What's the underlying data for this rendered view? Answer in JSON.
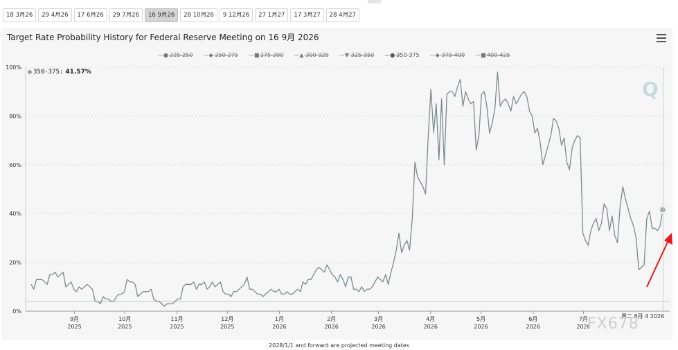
{
  "tabs": [
    {
      "label": "18 3月26",
      "active": false
    },
    {
      "label": "29 4月26",
      "active": false
    },
    {
      "label": "17 6月26",
      "active": false
    },
    {
      "label": "29 7月26",
      "active": false
    },
    {
      "label": "16 9月26",
      "active": true
    },
    {
      "label": "28 10月26",
      "active": false
    },
    {
      "label": "9 12月26",
      "active": false
    },
    {
      "label": "27 1月27",
      "active": false
    },
    {
      "label": "17 3月27",
      "active": false
    },
    {
      "label": "28 4月27",
      "active": false
    }
  ],
  "header": {
    "title": "Target Rate Probability History for Federal Reserve Meeting on 16 9月 2026"
  },
  "icons": {
    "menu": "hamburger-menu-icon",
    "logo": "q-logo-icon",
    "arrow": "red-arrow-icon"
  },
  "colors": {
    "line": "#7b8a8b",
    "marker": "#a0a0a0",
    "arrow": "#e8161a",
    "panel": "#f6f6f6"
  },
  "legend": [
    {
      "label": "225-250",
      "symbol": "●",
      "hidden": true
    },
    {
      "label": "250-275",
      "symbol": "◆",
      "hidden": true
    },
    {
      "label": "275-300",
      "symbol": "■",
      "hidden": true
    },
    {
      "label": "300-325",
      "symbol": "▲",
      "hidden": true
    },
    {
      "label": "325-350",
      "symbol": "▼",
      "hidden": true
    },
    {
      "label": "350-375",
      "symbol": "●",
      "hidden": false
    },
    {
      "label": "375-400",
      "symbol": "◆",
      "hidden": true
    },
    {
      "label": "400-425",
      "symbol": "■",
      "hidden": true
    }
  ],
  "tooltip": {
    "label": "350-375:",
    "value": "41.57%"
  },
  "logo_text": "Q",
  "hover_date": "周二 8月 4 2026",
  "watermark": "FX678",
  "footer": "2028/1/1 and forward are projected meeting dates",
  "chart_data": {
    "type": "line",
    "title": "Target Rate Probability History for Federal Reserve Meeting on 16 9月 2026",
    "ylim": [
      0,
      100
    ],
    "y_ticks": [
      "0%",
      "20%",
      "40%",
      "60%",
      "80%",
      "100%"
    ],
    "x_ticks": [
      {
        "month": "9月",
        "year": "2025"
      },
      {
        "month": "10月",
        "year": "2025"
      },
      {
        "month": "11月",
        "year": "2025"
      },
      {
        "month": "12月",
        "year": "2025"
      },
      {
        "month": "1月",
        "year": "2026"
      },
      {
        "month": "2月",
        "year": "2026"
      },
      {
        "month": "3月",
        "year": "2026"
      },
      {
        "month": "4月",
        "year": "2026"
      },
      {
        "month": "5月",
        "year": "2026"
      },
      {
        "month": "6月",
        "year": "2026"
      },
      {
        "month": "7月",
        "year": "2026"
      }
    ],
    "grid": true,
    "legend_position": "top",
    "series": [
      {
        "name": "350-375",
        "x_start": "2025-08-05",
        "x_end": "2026-08-04",
        "values": [
          11,
          9,
          13,
          13,
          13,
          12,
          11,
          15,
          15,
          16,
          14,
          15,
          16,
          10,
          11,
          12,
          9,
          8,
          10,
          9,
          10,
          11,
          10,
          9,
          4,
          4,
          3,
          6,
          5,
          5,
          4,
          4,
          6,
          7,
          7,
          8,
          13,
          12,
          12,
          11,
          6,
          7,
          8,
          8,
          8,
          9,
          5,
          4,
          4,
          3,
          2,
          3,
          3,
          3,
          4,
          5,
          5,
          10,
          11,
          11,
          11,
          12,
          9,
          11,
          11,
          12,
          9,
          10,
          12,
          10,
          11,
          12,
          8,
          7,
          7,
          6,
          8,
          8,
          9,
          10,
          11,
          14,
          9,
          9,
          8,
          7,
          7,
          6,
          7,
          8,
          9,
          8,
          8,
          9,
          7,
          7,
          8,
          7,
          7,
          8,
          9,
          8,
          12,
          11,
          13,
          13,
          15,
          17,
          18,
          17,
          16,
          19,
          17,
          15,
          14,
          12,
          15,
          13,
          10,
          14,
          14,
          9,
          9,
          8,
          10,
          8,
          9,
          9,
          10,
          12,
          14,
          13,
          12,
          15,
          11,
          16,
          20,
          25,
          32,
          24,
          27,
          29,
          25,
          38,
          61,
          55,
          53,
          51,
          48,
          72,
          91,
          73,
          85,
          62,
          87,
          60,
          89,
          90,
          90,
          88,
          92,
          95,
          84,
          90,
          87,
          85,
          86,
          66,
          72,
          89,
          90,
          84,
          73,
          77,
          83,
          98,
          84,
          86,
          87,
          85,
          82,
          88,
          85,
          87,
          89,
          90,
          88,
          82,
          80,
          73,
          75,
          69,
          60,
          64,
          68,
          72,
          79,
          78,
          75,
          68,
          71,
          61,
          58,
          67,
          70,
          72,
          71,
          32,
          29,
          27,
          33,
          36,
          38,
          33,
          36,
          44,
          42,
          33,
          39,
          31,
          28,
          43,
          51,
          46,
          42,
          38,
          35,
          30,
          17,
          18,
          19,
          38,
          41,
          34,
          34,
          33,
          35,
          41.57
        ]
      }
    ]
  }
}
